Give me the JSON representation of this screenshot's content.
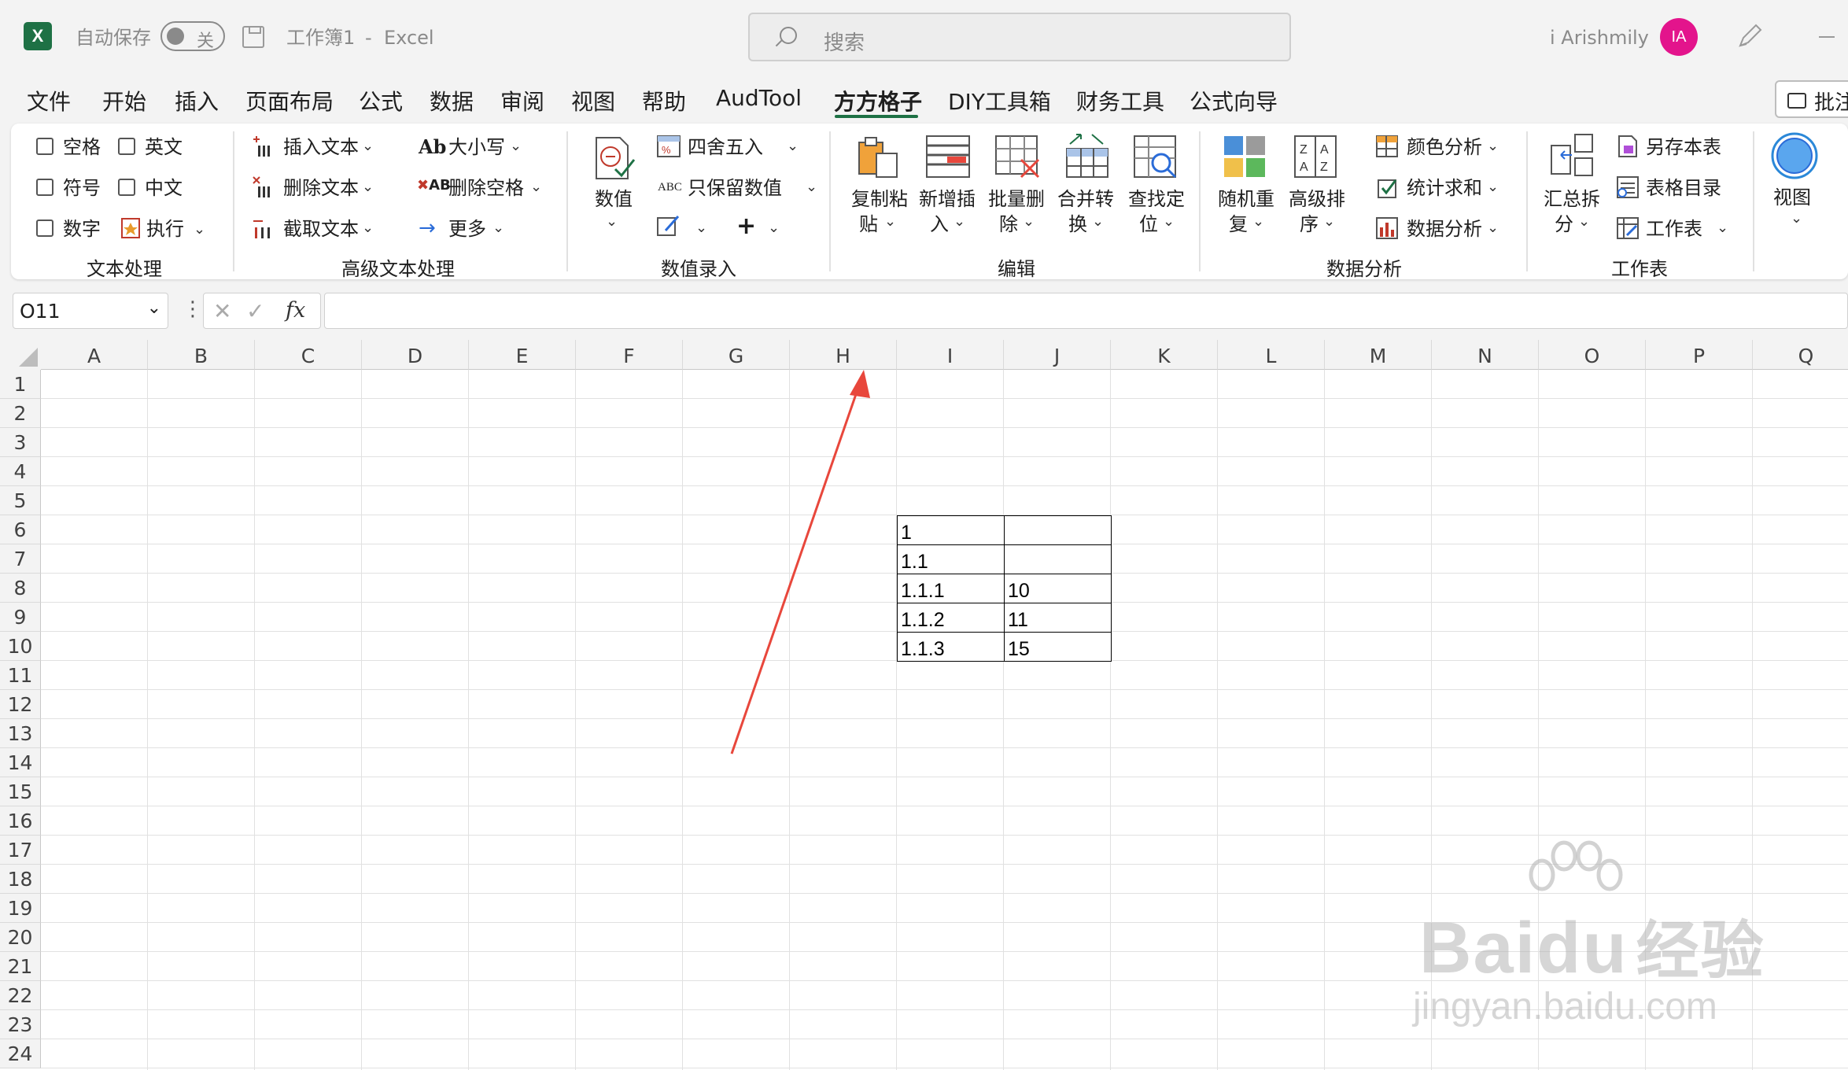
{
  "titlebar": {
    "autosave_label": "自动保存",
    "autosave_state": "关",
    "workbook": "工作簿1",
    "dash": "-",
    "app": "Excel",
    "search_placeholder": "搜索",
    "user_name": "i Arishmily",
    "avatar_initials": "IA",
    "app_icon_letter": "X"
  },
  "menu": {
    "tabs": [
      "文件",
      "开始",
      "插入",
      "页面布局",
      "公式",
      "数据",
      "审阅",
      "视图",
      "帮助",
      "AudTool",
      "方方格子",
      "DIY工具箱",
      "财务工具",
      "公式向导"
    ],
    "notes_label": "批注"
  },
  "ribbon": {
    "text_group": {
      "items": [
        "空格",
        "英文",
        "符号",
        "中文",
        "数字",
        "执行"
      ],
      "label": "文本处理"
    },
    "adv_text_group": {
      "items": [
        "插入文本",
        "删除文本",
        "截取文本",
        "大小写",
        "删除空格",
        "更多"
      ],
      "ab_glyph": "Ab",
      "ab_glyph2": "AB",
      "label": "高级文本处理"
    },
    "value_group": {
      "big": "数值",
      "items": [
        "四舍五入",
        "只保留数值"
      ],
      "abc_glyph": "ABC",
      "plus": "+",
      "label": "数值录入"
    },
    "edit_group": {
      "items": [
        [
          "复制粘",
          "贴"
        ],
        [
          "新增插",
          "入"
        ],
        [
          "批量删",
          "除"
        ],
        [
          "合并转",
          "换"
        ],
        [
          "查找定",
          "位"
        ]
      ],
      "label": "编辑"
    },
    "analysis_group": {
      "big": [
        [
          "随机重",
          "复"
        ],
        [
          "高级排",
          "序"
        ]
      ],
      "items": [
        "颜色分析",
        "统计求和",
        "数据分析"
      ],
      "label": "数据分析"
    },
    "sheet_group": {
      "big": [
        "汇总拆",
        "分"
      ],
      "items": [
        "另存本表",
        "表格目录",
        "工作表"
      ],
      "label": "工作表"
    },
    "view_group": {
      "big": "视图"
    }
  },
  "formula_bar": {
    "name_box": "O11",
    "fx": "fx",
    "content": ""
  },
  "sheet": {
    "columns": [
      "A",
      "B",
      "C",
      "D",
      "E",
      "F",
      "G",
      "H",
      "I",
      "J",
      "K",
      "L",
      "M",
      "N",
      "O",
      "P",
      "Q"
    ],
    "rows": [
      "1",
      "2",
      "3",
      "4",
      "5",
      "6",
      "7",
      "8",
      "9",
      "10",
      "11",
      "12",
      "13",
      "14",
      "15",
      "16",
      "17",
      "18",
      "19",
      "20",
      "21",
      "22",
      "23",
      "24"
    ],
    "table": [
      {
        "row": 6,
        "I": "1",
        "J": ""
      },
      {
        "row": 7,
        "I": "1.1",
        "J": ""
      },
      {
        "row": 8,
        "I": "1.1.1",
        "J": "10"
      },
      {
        "row": 9,
        "I": "1.1.2",
        "J": "11"
      },
      {
        "row": 10,
        "I": "1.1.3",
        "J": "15"
      }
    ]
  },
  "watermark": {
    "logo_a": "Bai",
    "logo_b": "du",
    "logo_c": "经验",
    "url": "jingyan.baidu.com"
  },
  "colors": {
    "excel_green": "#1e7145",
    "annotation_arrow": "#e8473c",
    "avatar": "#e3148c",
    "view_button": "#2b88d8"
  }
}
